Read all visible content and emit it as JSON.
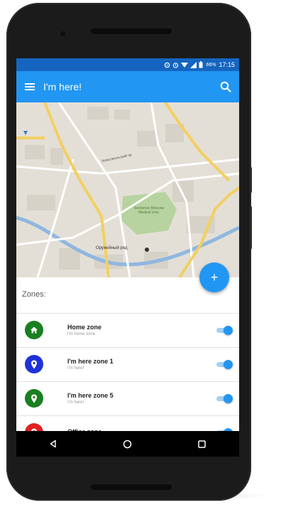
{
  "status_bar": {
    "battery": "66%",
    "time": "17:15"
  },
  "app_bar": {
    "title": "I'm here!",
    "menu_icon": "menu-icon",
    "search_icon": "search-icon"
  },
  "map": {
    "park_label": "Sechenov Moscow\nMedical Univ.",
    "place_label": "Оружейный ряд",
    "street_label": "Комсомольский пр"
  },
  "fab": {
    "label": "+"
  },
  "zones": {
    "header": "Zones:",
    "items": [
      {
        "name": "Home zone",
        "subtitle": "I'm home zone",
        "color": "#1a7f20",
        "icon": "home-icon",
        "enabled": true
      },
      {
        "name": "I'm here zone 1",
        "subtitle": "I'm here!",
        "color": "#1f32d8",
        "icon": "location-pin-icon",
        "enabled": true
      },
      {
        "name": "I'm here zone 5",
        "subtitle": "I'm here!",
        "color": "#1a7f20",
        "icon": "location-pin-icon",
        "enabled": true
      },
      {
        "name": "Office zone",
        "subtitle": "",
        "color": "#e02020",
        "icon": "location-pin-icon",
        "enabled": true
      }
    ]
  },
  "nav_bar": {
    "back": "◁",
    "home": "○",
    "recents": "□"
  }
}
